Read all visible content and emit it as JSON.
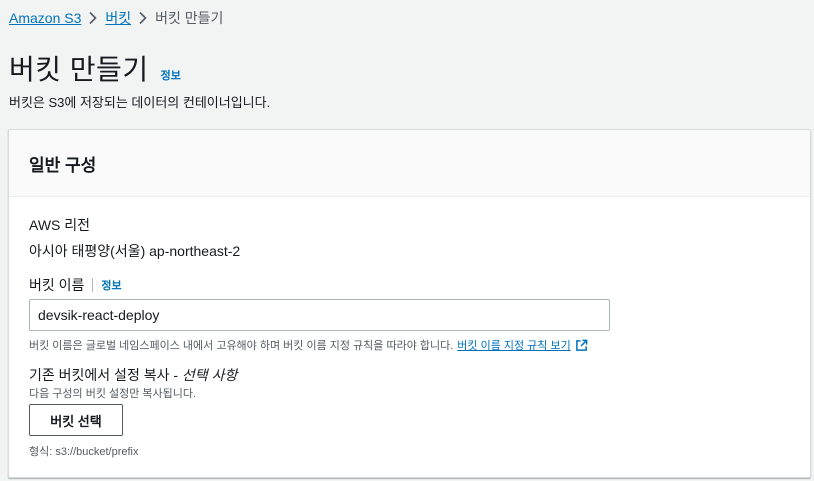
{
  "breadcrumb": {
    "root": "Amazon S3",
    "buckets": "버킷",
    "current": "버킷 만들기"
  },
  "page": {
    "title": "버킷 만들기",
    "info": "정보",
    "description": "버킷은 S3에 저장되는 데이터의 컨테이너입니다."
  },
  "general": {
    "title": "일반 구성",
    "region_label": "AWS 리전",
    "region_value": "아시아 태평양(서울) ap-northeast-2",
    "name_label": "버킷 이름",
    "name_info": "정보",
    "name_value": "devsik-react-deploy",
    "name_hint": "버킷 이름은 글로벌 네임스페이스 내에서 고유해야 하며 버킷 이름 지정 규칙을 따라야 합니다.",
    "name_rules_link": "버킷 이름 지정 규칙 보기",
    "copy_label": "기존 버킷에서 설정 복사 - ",
    "copy_optional": "선택 사항",
    "copy_desc": "다음 구성의 버킷 설정만 복사됩니다.",
    "choose_button": "버킷 선택",
    "format_hint": "형식: s3://bucket/prefix"
  },
  "colors": {
    "link": "#0073bb",
    "text": "#16191f",
    "muted": "#545b64",
    "background": "#f2f3f3"
  }
}
